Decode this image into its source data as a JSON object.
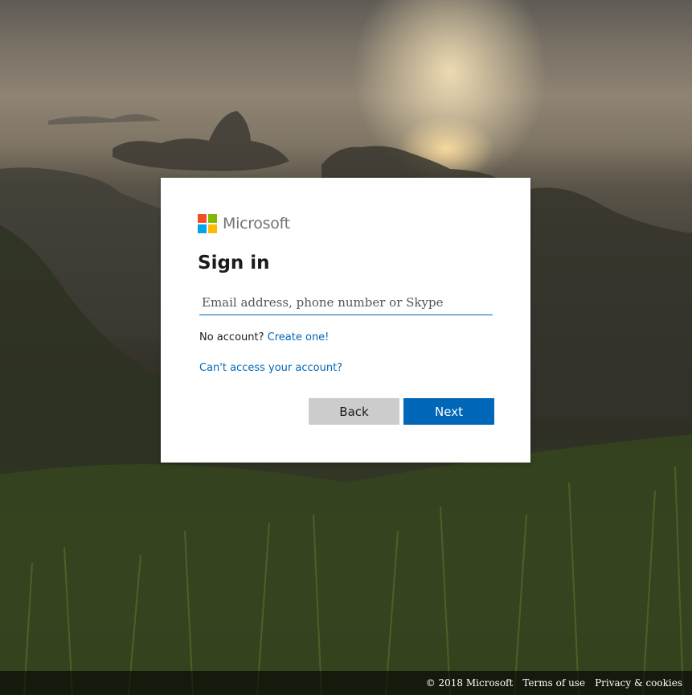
{
  "brand": {
    "name": "Microsoft"
  },
  "signin": {
    "title": "Sign in",
    "email_placeholder": "Email address, phone number or Skype",
    "email_value": "",
    "no_account_text": "No account?",
    "create_link": "Create one!",
    "cant_access_link": "Can't access your account?",
    "back_label": "Back",
    "next_label": "Next"
  },
  "footer": {
    "copyright": "© 2018 Microsoft",
    "terms": "Terms of use",
    "privacy": "Privacy & cookies"
  },
  "colors": {
    "accent": "#0067b8",
    "logo_red": "#f25022",
    "logo_green": "#7fba00",
    "logo_blue": "#00a4ef",
    "logo_yellow": "#ffb900"
  }
}
